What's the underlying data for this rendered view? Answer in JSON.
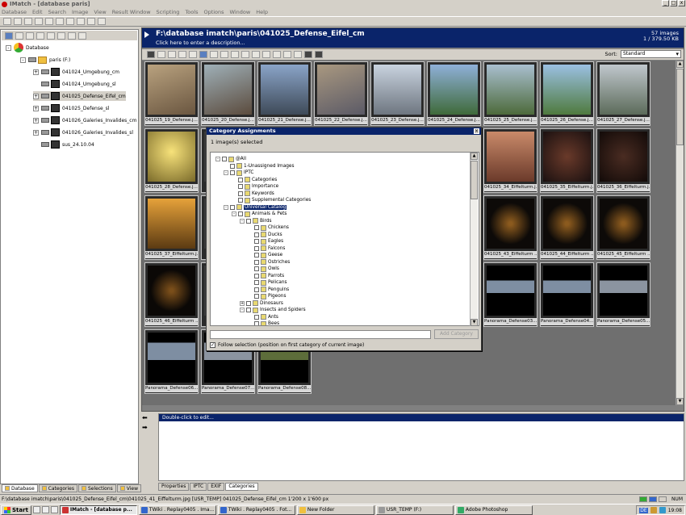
{
  "app": {
    "title": "IMatch - [database paris]"
  },
  "menu": [
    "Database",
    "Edit",
    "Search",
    "Image",
    "View",
    "Result Window",
    "Scripting",
    "Tools",
    "Options",
    "Window",
    "Help"
  ],
  "tree": {
    "root": "Database",
    "drive": "paris (F:)",
    "items": [
      "041024_Umgebung_cm",
      "041024_Umgebung_sl",
      "041025_Defense_Eifel_cm",
      "041025_Defense_sl",
      "041026_Galeries_Invalides_cm",
      "041026_Galeries_Invalides_sl",
      "sus_24.10.04"
    ]
  },
  "left_tabs": [
    "Database",
    "Categories",
    "Selections",
    "View"
  ],
  "header": {
    "path": "F:\\database imatch\\paris\\041025_Defense_Eifel_cm",
    "description_hint": "Click here to enter a description...",
    "count": "57 images",
    "selection": "1 / 379.50 KB"
  },
  "sort": {
    "label": "Sort:",
    "value": "Standard"
  },
  "thumbnails": [
    "041025_19_Defense.j...",
    "041025_20_Defense.j...",
    "041025_21_Defense.j...",
    "041025_22_Defense.j...",
    "041025_23_Defense.j...",
    "041025_24_Defense.j...",
    "041025_25_Defense.j...",
    "041025_26_Defense.j...",
    "041025_27_Defense.j...",
    "041025_28_Defense.j...",
    "041025_34_Eiffelturm.j...",
    "041025_35_Eiffelturm.j...",
    "041025_36_Eiffelturm.j...",
    "041025_37_Eiffelturm.j...",
    "041025_43_Eiffelturm ...",
    "041025_44_Eiffelturm ...",
    "041025_45_Eiffelturm ...",
    "041025_46_Eiffelturm ...",
    "Panorama_Defense03...",
    "Panorama_Defense04...",
    "Panorama_Defense05...",
    "Panorama_Defense06...",
    "Panorama_Defense07...",
    "Panorama_Defense08..."
  ],
  "dialog": {
    "title": "Category Assignments",
    "selected": "1 image(s) selected",
    "add_button": "Add Category",
    "follow": "Follow selection (position on first category of current image)",
    "categories": [
      {
        "label": "@All",
        "depth": 0
      },
      {
        "label": "1-Unassigned Images",
        "depth": 1
      },
      {
        "label": "IPTC",
        "depth": 1
      },
      {
        "label": "Categories",
        "depth": 2
      },
      {
        "label": "Importance",
        "depth": 2
      },
      {
        "label": "Keywords",
        "depth": 2
      },
      {
        "label": "Supplemental Categories",
        "depth": 2
      },
      {
        "label": "Universal Catalog",
        "depth": 1
      },
      {
        "label": "Animals & Pets",
        "depth": 2
      },
      {
        "label": "Birds",
        "depth": 3
      },
      {
        "label": "Chickens",
        "depth": 4
      },
      {
        "label": "Ducks",
        "depth": 4
      },
      {
        "label": "Eagles",
        "depth": 4
      },
      {
        "label": "Falcons",
        "depth": 4
      },
      {
        "label": "Geese",
        "depth": 4
      },
      {
        "label": "Ostriches",
        "depth": 4
      },
      {
        "label": "Owls",
        "depth": 4
      },
      {
        "label": "Parrots",
        "depth": 4
      },
      {
        "label": "Pelicans",
        "depth": 4
      },
      {
        "label": "Penguins",
        "depth": 4
      },
      {
        "label": "Pigeons",
        "depth": 4
      },
      {
        "label": "Dinosaurs",
        "depth": 3
      },
      {
        "label": "Insects and Spiders",
        "depth": 3
      },
      {
        "label": "Ants",
        "depth": 4
      },
      {
        "label": "Bees",
        "depth": 4
      }
    ]
  },
  "edit": {
    "hint": "Double-click to edit..."
  },
  "edit_tabs": [
    "Properties",
    "IPTC",
    "EXIF",
    "Categories"
  ],
  "status": {
    "text": "F:\\database imatch\\paris\\041025_Defense_Eifel_cm\\041025_41_Eiffelturm.jpg [USR_TEMP]  041025_Defense_Eifel_cm  1'200 x 1'600 px",
    "num": "NUM"
  },
  "taskbar": {
    "start": "Start",
    "tasks": [
      "IMatch - [database p...",
      "TWiki . Replay0405 . Ima...",
      "TWiki . Replay0405 . Fot...",
      "New Folder",
      "USR_TEMP (F:)",
      "Adobe Photoshop"
    ],
    "lang": "DE",
    "clock": "19:08"
  }
}
